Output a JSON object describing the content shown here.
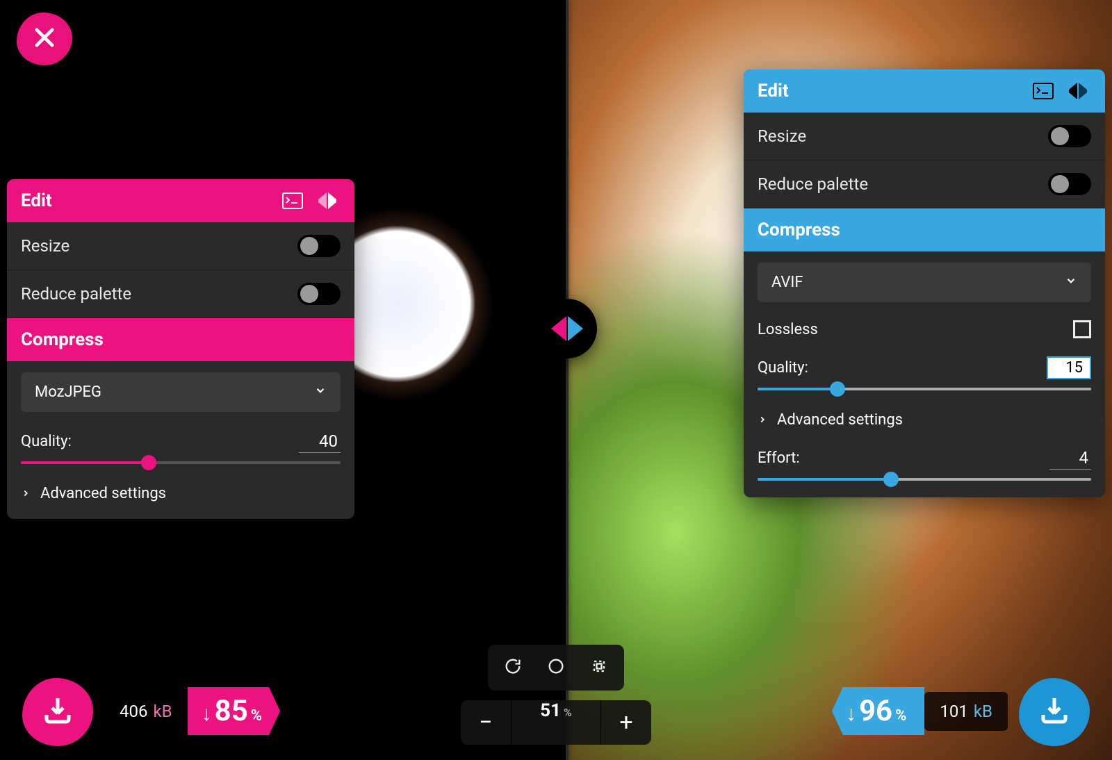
{
  "colors": {
    "pink": "#ec1380",
    "blue": "#39a7e0"
  },
  "close": {
    "label": "Close"
  },
  "left": {
    "edit_title": "Edit",
    "resize_label": "Resize",
    "resize_on": false,
    "reduce_palette_label": "Reduce palette",
    "reduce_palette_on": false,
    "compress_title": "Compress",
    "codec": "MozJPEG",
    "quality_label": "Quality:",
    "quality_value": "40",
    "quality_pct": 40,
    "advanced_label": "Advanced settings",
    "file_size_value": "406",
    "file_size_unit": "kB",
    "reduction_pct": "85"
  },
  "right": {
    "edit_title": "Edit",
    "resize_label": "Resize",
    "resize_on": false,
    "reduce_palette_label": "Reduce palette",
    "reduce_palette_on": false,
    "compress_title": "Compress",
    "codec": "AVIF",
    "lossless_label": "Lossless",
    "lossless_checked": false,
    "quality_label": "Quality:",
    "quality_value": "15",
    "quality_pct": 15,
    "advanced_label": "Advanced settings",
    "effort_label": "Effort:",
    "effort_value": "4",
    "effort_pct": 40,
    "file_size_value": "101",
    "file_size_unit": "kB",
    "reduction_pct": "96"
  },
  "zoom": {
    "value": "51",
    "unit": "%",
    "compare_split_pct": 51
  },
  "toolbar": {
    "rotate": "Rotate",
    "background": "Toggle background",
    "crop": "Edit region"
  }
}
